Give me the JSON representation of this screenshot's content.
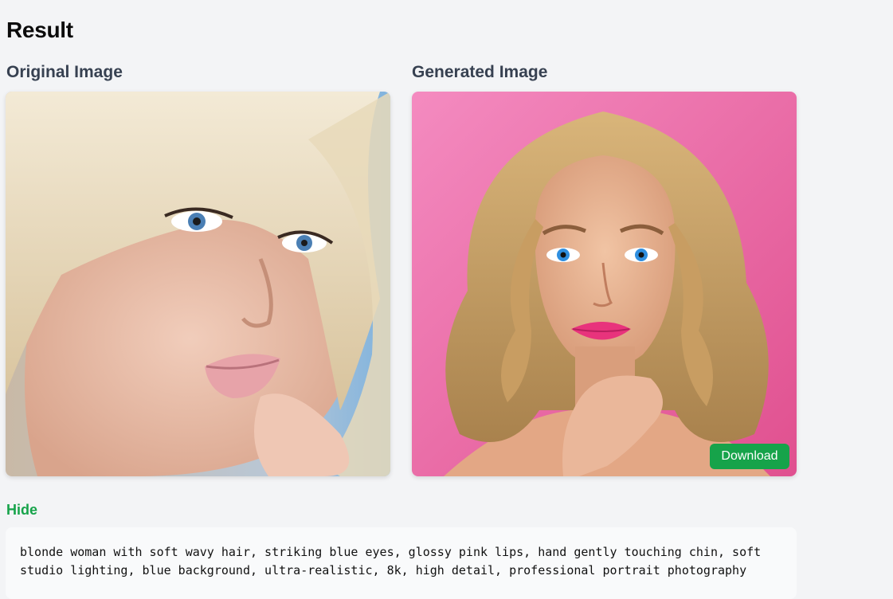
{
  "result": {
    "title": "Result"
  },
  "original": {
    "label": "Original Image"
  },
  "generated": {
    "label": "Generated Image",
    "download_label": "Download"
  },
  "prompt": {
    "toggle_label": "Hide",
    "text": "blonde woman with soft wavy hair, striking blue eyes, glossy pink lips, hand gently touching chin, soft studio lighting, blue background, ultra-realistic, 8k, high detail, professional portrait photography"
  },
  "colors": {
    "background": "#f3f4f6",
    "accent_green": "#16a34a",
    "label_gray": "#374151"
  }
}
